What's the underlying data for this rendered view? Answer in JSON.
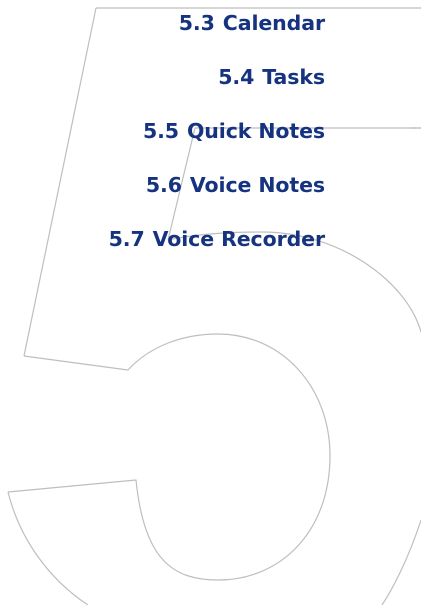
{
  "colors": {
    "heading_text": "#15337f",
    "numeral_outline": "#bebebe",
    "background": "#ffffff"
  },
  "chapter_numeral": "5",
  "sections": [
    {
      "number": "5.3",
      "title": "Calendar"
    },
    {
      "number": "5.4",
      "title": "Tasks"
    },
    {
      "number": "5.5",
      "title": "Quick Notes"
    },
    {
      "number": "5.6",
      "title": "Voice Notes"
    },
    {
      "number": "5.7",
      "title": "Voice Recorder"
    }
  ]
}
